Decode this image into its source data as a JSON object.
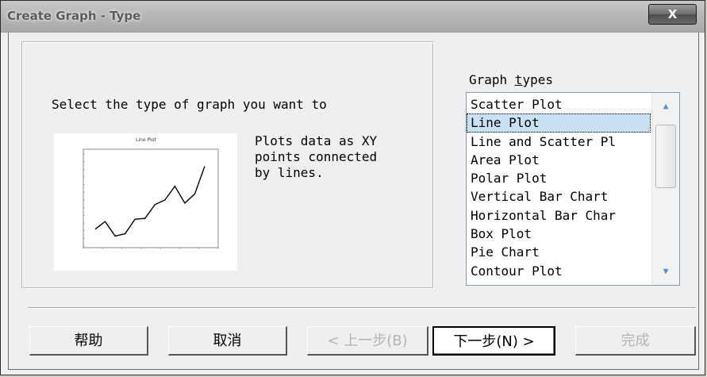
{
  "window": {
    "title": "Create Graph - Type",
    "close_label": "X"
  },
  "main": {
    "prompt": "Select the type of graph you want to",
    "description": "Plots data as XY\npoints connected\nby lines."
  },
  "list": {
    "label_before": "Graph ",
    "label_mnemonic": "t",
    "label_after": "ypes",
    "items": [
      "Scatter Plot",
      "Line Plot",
      "Line and Scatter Pl",
      "Area Plot",
      "Polar Plot",
      "Vertical Bar Chart",
      "Horizontal Bar Char",
      "Box Plot",
      "Pie Chart",
      "Contour Plot"
    ],
    "selected_index": 1
  },
  "buttons": {
    "help": "帮助",
    "cancel": "取消",
    "back": "< 上一步(B)",
    "next": "下一步(N) >",
    "finish": "完成"
  },
  "preview": {
    "title": "Line Plot"
  },
  "chart_data": {
    "type": "line",
    "title": "Line Plot",
    "series": [
      {
        "values": [
          2.2,
          3.2,
          1.3,
          1.6,
          3.5,
          3.6,
          5.4,
          6.0,
          7.8,
          5.6,
          6.8,
          10.4
        ]
      }
    ],
    "ylim": [
      0,
      12
    ]
  },
  "colors": {
    "selection": "#c8e1f4",
    "scroll_arrow": "#4a8ed6"
  }
}
